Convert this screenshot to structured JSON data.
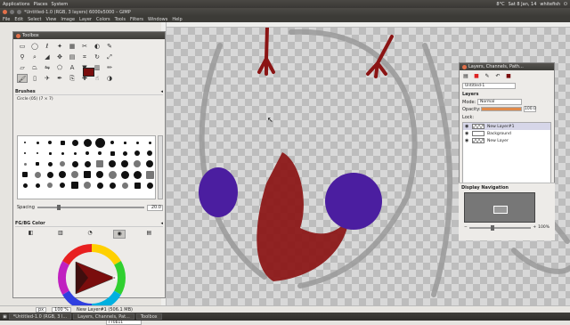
{
  "top_panel": {
    "menus": [
      "Applications",
      "Places",
      "System"
    ],
    "weather": "8°C",
    "clock": "Sat 8 Jan, 14",
    "user": "whitefish"
  },
  "gimp_window": {
    "title": "*Untitled-1.0 (RGB, 3 layers) 6000x5000 – GIMP",
    "menu": [
      "File",
      "Edit",
      "Select",
      "View",
      "Image",
      "Layer",
      "Colors",
      "Tools",
      "Filters",
      "Windows",
      "Help"
    ]
  },
  "toolbox": {
    "title": "Toolbox",
    "tools": [
      {
        "icon": "rect-select-icon",
        "glyph": "▭"
      },
      {
        "icon": "ellipse-select-icon",
        "glyph": "◯"
      },
      {
        "icon": "free-select-icon",
        "glyph": "ℓ"
      },
      {
        "icon": "fuzzy-select-icon",
        "glyph": "✦"
      },
      {
        "icon": "color-select-icon",
        "glyph": "▦"
      },
      {
        "icon": "scissors-icon",
        "glyph": "✂"
      },
      {
        "icon": "foreground-select-icon",
        "glyph": "◐"
      },
      {
        "icon": "paths-icon",
        "glyph": "✎"
      },
      {
        "icon": "color-picker-icon",
        "glyph": "⚲"
      },
      {
        "icon": "zoom-icon",
        "glyph": "⌕"
      },
      {
        "icon": "measure-icon",
        "glyph": "◢"
      },
      {
        "icon": "move-icon",
        "glyph": "✥"
      },
      {
        "icon": "align-icon",
        "glyph": "▤"
      },
      {
        "icon": "crop-icon",
        "glyph": "⌗"
      },
      {
        "icon": "rotate-icon",
        "glyph": "↻"
      },
      {
        "icon": "scale-icon",
        "glyph": "⤢"
      },
      {
        "icon": "shear-icon",
        "glyph": "▱"
      },
      {
        "icon": "perspective-icon",
        "glyph": "⏢"
      },
      {
        "icon": "flip-icon",
        "glyph": "⇋"
      },
      {
        "icon": "cage-icon",
        "glyph": "⬠"
      },
      {
        "icon": "text-icon",
        "glyph": "A"
      },
      {
        "icon": "bucket-fill-icon",
        "glyph": "▼"
      },
      {
        "icon": "blend-icon",
        "glyph": "▥"
      },
      {
        "icon": "pencil-icon",
        "glyph": "✏"
      },
      {
        "icon": "paintbrush-icon",
        "glyph": "🖌"
      },
      {
        "icon": "eraser-icon",
        "glyph": "▯"
      },
      {
        "icon": "airbrush-icon",
        "glyph": "✈"
      },
      {
        "icon": "ink-icon",
        "glyph": "✒"
      },
      {
        "icon": "clone-icon",
        "glyph": "⎘"
      },
      {
        "icon": "heal-icon",
        "glyph": "✚"
      },
      {
        "icon": "smudge-icon",
        "glyph": "☝"
      },
      {
        "icon": "dodge-burn-icon",
        "glyph": "◑"
      }
    ],
    "active_tool_index": 24,
    "fg_color": "#7a0d0d",
    "bg_color": "#ffffff",
    "brushes_header": "Brushes",
    "brush_name": "Circle (05) (7 × 7)",
    "spacing_label": "Spacing",
    "spacing_value": "20.0",
    "color_header": "FG/BG Color",
    "hex_value": "770b11"
  },
  "layers_dock": {
    "title": "Layers, Channels, Path...",
    "image_select": "Untitled-1",
    "layers_header": "Layers",
    "mode_label": "Mode:",
    "mode_value": "Normal",
    "opacity_label": "Opacity:",
    "opacity_value": "100.0",
    "opacity_fraction": 1.0,
    "lock_label": "Lock:",
    "layers": [
      {
        "name": "New Layer#1",
        "selected": true
      },
      {
        "name": "Background",
        "selected": false
      },
      {
        "name": "New Layer",
        "selected": false
      }
    ],
    "nav_header": "Display Navigation",
    "nav_zoom": "100%"
  },
  "statusbar": {
    "unit": "px",
    "zoom": "100 %",
    "message": "New Layer#1 (506.1 MB)"
  },
  "taskbar": {
    "items": [
      "*Untitled-1.0 (RGB, 3 l...",
      "Layers, Channels, Pat...",
      "Toolbox"
    ]
  },
  "colors": {
    "paint_red": "#8b1414",
    "paint_purple": "#4b1ea0",
    "sketch_gray": "#9a9a9a"
  }
}
